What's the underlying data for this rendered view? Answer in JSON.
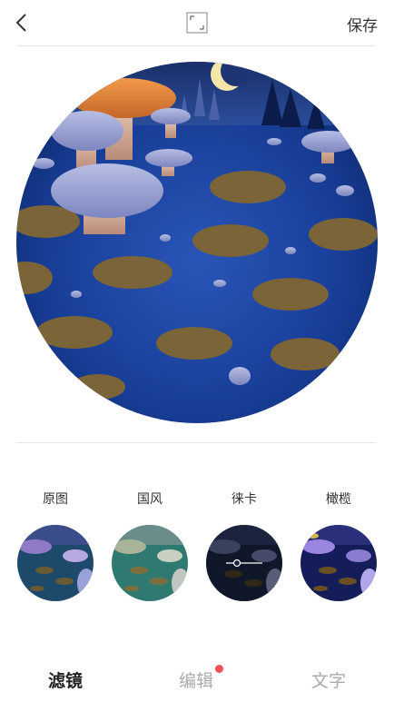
{
  "header": {
    "save_label": "保存"
  },
  "filters": [
    {
      "label": "原图"
    },
    {
      "label": "国风"
    },
    {
      "label": "徕卡"
    },
    {
      "label": "橄榄"
    }
  ],
  "tabs": [
    {
      "label": "滤镜",
      "active": true
    },
    {
      "label": "编辑",
      "active": false,
      "badge": true
    },
    {
      "label": "文字",
      "active": false
    }
  ],
  "colors": {
    "badge": "#f0505a",
    "active_tab": "#222222",
    "inactive_tab": "#aaaaaa"
  },
  "icons": {
    "back": "chevron-left-icon",
    "frame": "crop-frame-icon",
    "edit_overlay": "slider-adjust-icon"
  }
}
